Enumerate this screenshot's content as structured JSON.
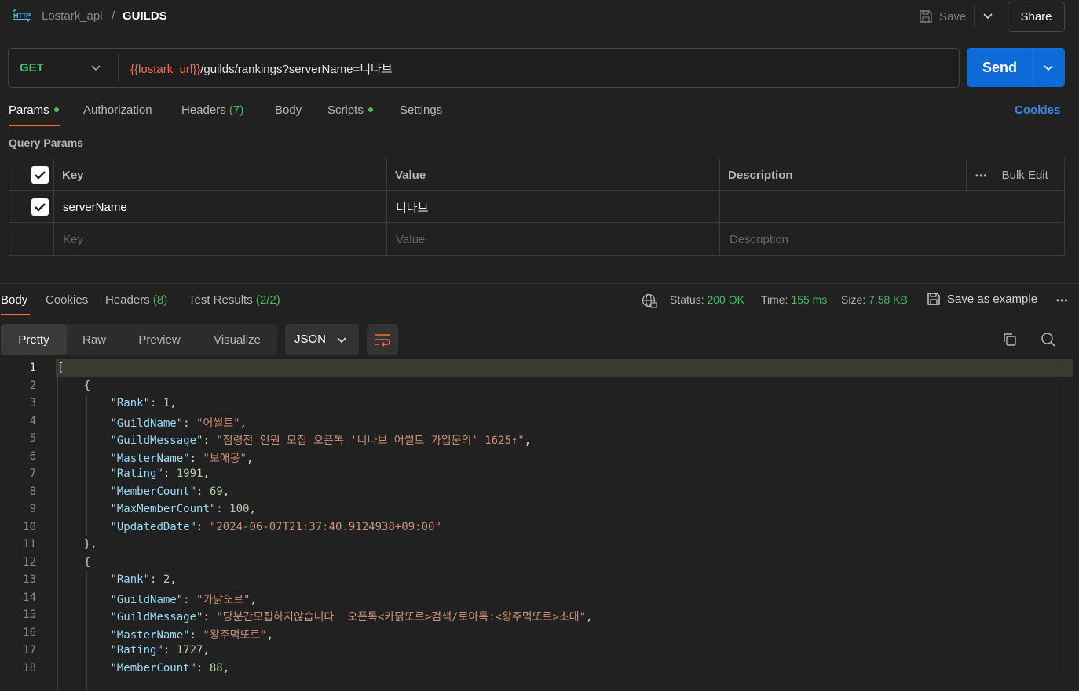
{
  "header": {
    "collection": "Lostark_api",
    "separator": "/",
    "request_name": "GUILDS",
    "save_label": "Save",
    "share_label": "Share"
  },
  "request": {
    "method": "GET",
    "url_variable": "{{lostark_url}}",
    "url_path": "/guilds/rankings?serverName=니나브",
    "send_label": "Send"
  },
  "request_tabs": {
    "params": "Params",
    "authorization": "Authorization",
    "headers": "Headers",
    "headers_count": "(7)",
    "body": "Body",
    "scripts": "Scripts",
    "settings": "Settings",
    "cookies": "Cookies"
  },
  "query_params": {
    "title": "Query Params",
    "columns": {
      "key": "Key",
      "value": "Value",
      "description": "Description"
    },
    "bulk_edit": "Bulk Edit",
    "rows": [
      {
        "key": "serverName",
        "value": "니나브",
        "description": ""
      }
    ],
    "placeholders": {
      "key": "Key",
      "value": "Value",
      "description": "Description"
    }
  },
  "response_tabs": {
    "body": "Body",
    "cookies": "Cookies",
    "headers": "Headers",
    "headers_count": "(8)",
    "tests": "Test Results",
    "tests_count": "(2/2)"
  },
  "response_stats": {
    "status_label": "Status:",
    "status_value": "200 OK",
    "time_label": "Time:",
    "time_value": "155 ms",
    "size_label": "Size:",
    "size_value": "7.58 KB",
    "save_example": "Save as example"
  },
  "format_bar": {
    "modes": [
      "Pretty",
      "Raw",
      "Preview",
      "Visualize"
    ],
    "active_mode": "Pretty",
    "language": "JSON"
  },
  "code_lines": [
    [
      [
        "p",
        "["
      ]
    ],
    [
      [
        "p",
        "    {"
      ]
    ],
    [
      [
        "p",
        "        "
      ],
      [
        "k",
        "\"Rank\""
      ],
      [
        "p",
        ": "
      ],
      [
        "n",
        "1"
      ],
      [
        "p",
        ","
      ]
    ],
    [
      [
        "p",
        "        "
      ],
      [
        "k",
        "\"GuildName\""
      ],
      [
        "p",
        ": "
      ],
      [
        "s",
        "\"어썰트\""
      ],
      [
        "p",
        ","
      ]
    ],
    [
      [
        "p",
        "        "
      ],
      [
        "k",
        "\"GuildMessage\""
      ],
      [
        "p",
        ": "
      ],
      [
        "s",
        "\"점령전 인원 모집 오픈톡 '니나브 어썰트 가입문의' 1625↑\""
      ],
      [
        "p",
        ","
      ]
    ],
    [
      [
        "p",
        "        "
      ],
      [
        "k",
        "\"MasterName\""
      ],
      [
        "p",
        ": "
      ],
      [
        "s",
        "\"보애몽\""
      ],
      [
        "p",
        ","
      ]
    ],
    [
      [
        "p",
        "        "
      ],
      [
        "k",
        "\"Rating\""
      ],
      [
        "p",
        ": "
      ],
      [
        "n",
        "1991"
      ],
      [
        "p",
        ","
      ]
    ],
    [
      [
        "p",
        "        "
      ],
      [
        "k",
        "\"MemberCount\""
      ],
      [
        "p",
        ": "
      ],
      [
        "n",
        "69"
      ],
      [
        "p",
        ","
      ]
    ],
    [
      [
        "p",
        "        "
      ],
      [
        "k",
        "\"MaxMemberCount\""
      ],
      [
        "p",
        ": "
      ],
      [
        "n",
        "100"
      ],
      [
        "p",
        ","
      ]
    ],
    [
      [
        "p",
        "        "
      ],
      [
        "k",
        "\"UpdatedDate\""
      ],
      [
        "p",
        ": "
      ],
      [
        "s",
        "\"2024-06-07T21:37:40.9124938+09:00\""
      ]
    ],
    [
      [
        "p",
        "    },"
      ]
    ],
    [
      [
        "p",
        "    {"
      ]
    ],
    [
      [
        "p",
        "        "
      ],
      [
        "k",
        "\"Rank\""
      ],
      [
        "p",
        ": "
      ],
      [
        "n",
        "2"
      ],
      [
        "p",
        ","
      ]
    ],
    [
      [
        "p",
        "        "
      ],
      [
        "k",
        "\"GuildName\""
      ],
      [
        "p",
        ": "
      ],
      [
        "s",
        "\"카닭또르\""
      ],
      [
        "p",
        ","
      ]
    ],
    [
      [
        "p",
        "        "
      ],
      [
        "k",
        "\"GuildMessage\""
      ],
      [
        "p",
        ": "
      ],
      [
        "s",
        "\"당분간모집하지않습니다  오픈톡<카닭또르>검색/로아톡:<왕주먹또르>초대\""
      ],
      [
        "p",
        ","
      ]
    ],
    [
      [
        "p",
        "        "
      ],
      [
        "k",
        "\"MasterName\""
      ],
      [
        "p",
        ": "
      ],
      [
        "s",
        "\"왕주먹또르\""
      ],
      [
        "p",
        ","
      ]
    ],
    [
      [
        "p",
        "        "
      ],
      [
        "k",
        "\"Rating\""
      ],
      [
        "p",
        ": "
      ],
      [
        "n",
        "1727"
      ],
      [
        "p",
        ","
      ]
    ],
    [
      [
        "p",
        "        "
      ],
      [
        "k",
        "\"MemberCount\""
      ],
      [
        "p",
        ": "
      ],
      [
        "n",
        "88"
      ],
      [
        "p",
        ","
      ]
    ]
  ],
  "colors": {
    "background": "#212121",
    "accent": "#ff6c37",
    "send": "#0d6ad6",
    "method_get": "#40c463",
    "url_variable": "#ff6b4a",
    "json_key": "#9cdcfe",
    "json_string": "#ce9178",
    "json_number": "#b5cea8"
  }
}
